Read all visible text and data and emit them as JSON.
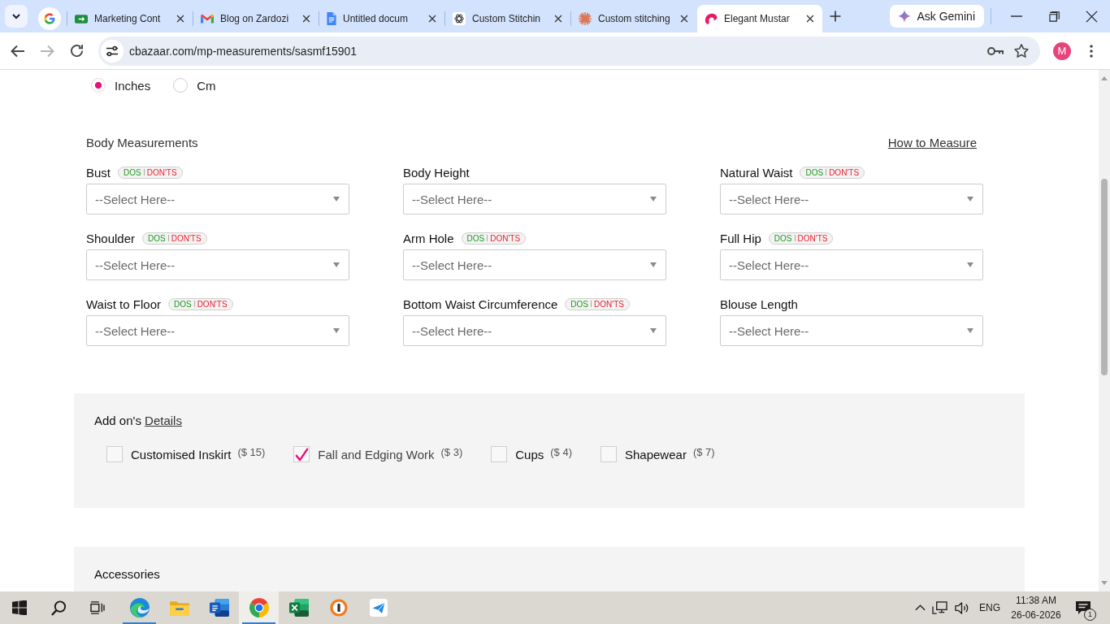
{
  "browser": {
    "tabs": [
      {
        "selected": false
      },
      {
        "title": "Marketing Cont",
        "selected": false
      },
      {
        "title": "Blog on Zardozi",
        "selected": false
      },
      {
        "title": "Untitled docum",
        "selected": false
      },
      {
        "title": "Custom Stitchin",
        "selected": false
      },
      {
        "title": "Custom stitching",
        "selected": false
      },
      {
        "title": "Elegant Mustar",
        "selected": true
      }
    ],
    "gemini_button": "Ask Gemini",
    "forward_disabled": true,
    "address": "cbazaar.com/mp-measurements/sasmf15901",
    "profile_initial": "M"
  },
  "page": {
    "units": [
      {
        "label": "Inches",
        "selected": true
      },
      {
        "label": "Cm",
        "selected": false
      }
    ],
    "body_measurements": {
      "title": "Body Measurements",
      "help_link": "How to Measure",
      "fields": [
        {
          "label": "Bust",
          "dos": "DOS",
          "donts": "DON'TS",
          "placeholder": "--Select Here--"
        },
        {
          "label": "Body Height",
          "placeholder": "--Select Here--"
        },
        {
          "label": "Natural Waist",
          "dos": "DOS",
          "donts": "DON'TS",
          "placeholder": "--Select Here--"
        },
        {
          "label": "Shoulder",
          "dos": "DOS",
          "donts": "DON'TS",
          "placeholder": "--Select Here--"
        },
        {
          "label": "Arm Hole",
          "dos": "DOS",
          "donts": "DON'TS",
          "placeholder": "--Select Here--"
        },
        {
          "label": "Full Hip",
          "dos": "DOS",
          "donts": "DON'TS",
          "placeholder": "--Select Here--"
        },
        {
          "label": "Waist to Floor",
          "dos": "DOS",
          "donts": "DON'TS",
          "placeholder": "--Select Here--"
        },
        {
          "label": "Bottom Waist Circumference",
          "dos": "DOS",
          "donts": "DON'TS",
          "placeholder": "--Select Here--"
        },
        {
          "label": "Blouse Length",
          "placeholder": "--Select Here--"
        }
      ]
    },
    "addons": {
      "title": "Add on's",
      "link": "Details",
      "items": [
        {
          "label": "Customised Inskirt",
          "price": "($ 15)",
          "checked": false
        },
        {
          "label": "Fall and Edging Work",
          "price": "($ 3)",
          "checked": true
        },
        {
          "label": "Cups",
          "price": "($ 4)",
          "checked": false
        },
        {
          "label": "Shapewear",
          "price": "($ 7)",
          "checked": false
        }
      ]
    },
    "accessories": {
      "title": "Accessories"
    }
  },
  "taskbar": {
    "apps": [
      {
        "active": false,
        "running": true
      },
      {
        "active": false,
        "running": false
      },
      {
        "active": false,
        "running": false
      },
      {
        "active": true,
        "running": true
      },
      {
        "active": false,
        "running": false
      },
      {
        "active": false,
        "running": false
      },
      {
        "active": false,
        "running": false
      }
    ],
    "language": "ENG",
    "time": "11:38 AM",
    "date": "26-06-2026",
    "notification_count": "1"
  }
}
